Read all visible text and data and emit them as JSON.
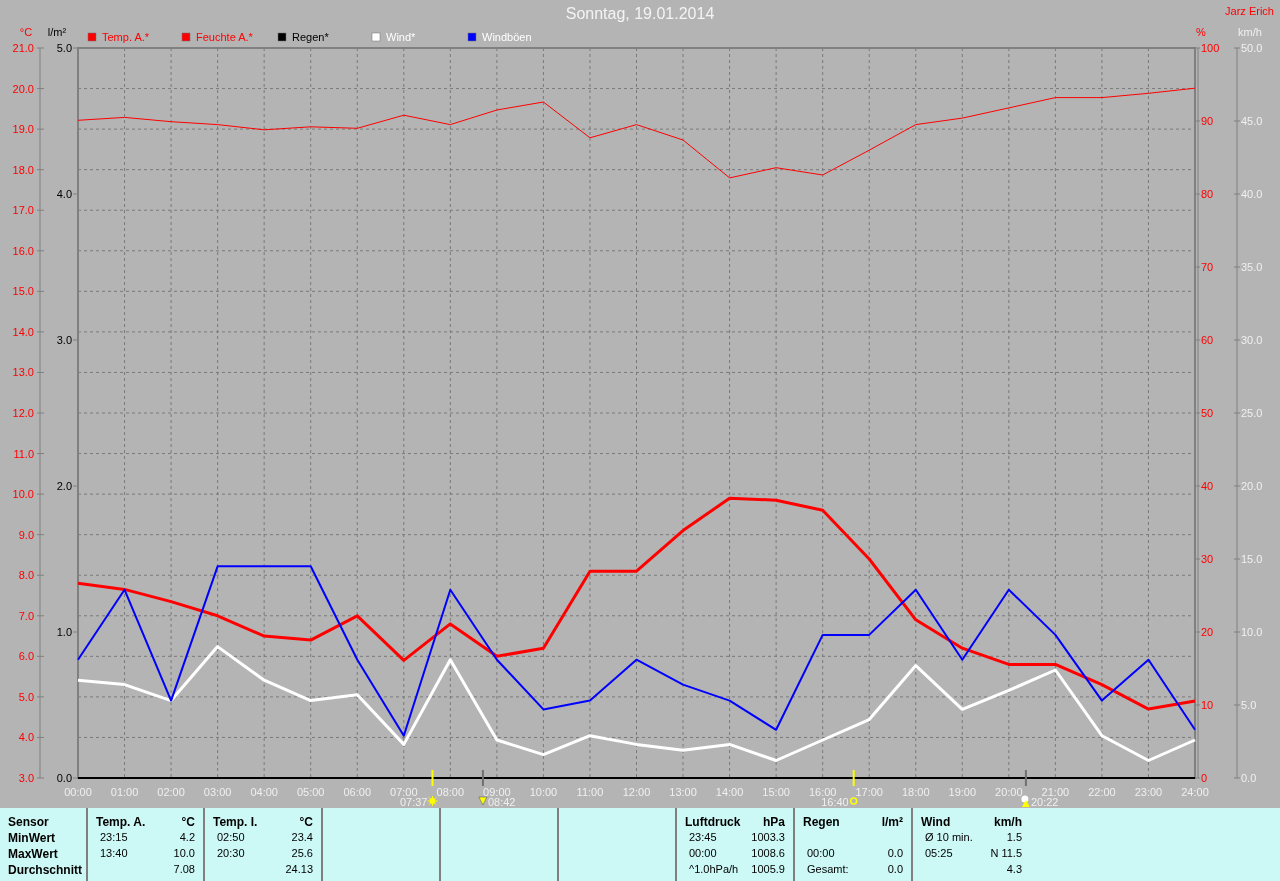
{
  "header": {
    "title": "Sonntag, 19.01.2014",
    "author": "Jarz Erich"
  },
  "chart": {
    "rain_axis": {
      "unit": "l/m²",
      "ticks": [
        "5.0",
        "4.0",
        "3.0",
        "2.0",
        "1.0",
        "0.0"
      ]
    },
    "events": [
      "07:37",
      "08:42",
      "16:40",
      "20:22"
    ],
    "chart_data": {
      "type": "line",
      "grid": true,
      "legend": "top",
      "ylabel": "°C",
      "y2label": "%",
      "y3label": "km/h",
      "ylim": [
        3,
        21
      ],
      "y2lim": [
        0,
        100
      ],
      "y3lim": [
        0,
        50
      ],
      "xlim": [
        0,
        24
      ],
      "x": [
        0,
        1,
        2,
        3,
        4,
        5,
        6,
        7,
        8,
        9,
        10,
        11,
        12,
        13,
        14,
        15,
        16,
        17,
        18,
        19,
        20,
        21,
        22,
        23,
        24
      ],
      "xticks": [
        {
          "value": 0,
          "label": "00:00"
        },
        {
          "value": 1,
          "label": "01:00"
        },
        {
          "value": 2,
          "label": "02:00"
        },
        {
          "value": 3,
          "label": "03:00"
        },
        {
          "value": 4,
          "label": "04:00"
        },
        {
          "value": 5,
          "label": "05:00"
        },
        {
          "value": 6,
          "label": "06:00"
        },
        {
          "value": 7,
          "label": "07:00"
        },
        {
          "value": 8,
          "label": "08:00"
        },
        {
          "value": 9,
          "label": "09:00"
        },
        {
          "value": 10,
          "label": "10:00"
        },
        {
          "value": 11,
          "label": "11:00"
        },
        {
          "value": 12,
          "label": "12:00"
        },
        {
          "value": 13,
          "label": "13:00"
        },
        {
          "value": 14,
          "label": "14:00"
        },
        {
          "value": 15,
          "label": "15:00"
        },
        {
          "value": 16,
          "label": "16:00"
        },
        {
          "value": 17,
          "label": "17:00"
        },
        {
          "value": 18,
          "label": "18:00"
        },
        {
          "value": 19,
          "label": "19:00"
        },
        {
          "value": 20,
          "label": "20:00"
        },
        {
          "value": 21,
          "label": "21:00"
        },
        {
          "value": 22,
          "label": "22:00"
        },
        {
          "value": 23,
          "label": "23:00"
        },
        {
          "value": 24,
          "label": "24:00"
        }
      ],
      "yticks": [
        {
          "value": 3,
          "label": "3.0"
        },
        {
          "value": 4,
          "label": "4.0"
        },
        {
          "value": 5,
          "label": "5.0"
        },
        {
          "value": 6,
          "label": "6.0"
        },
        {
          "value": 7,
          "label": "7.0"
        },
        {
          "value": 8,
          "label": "8.0"
        },
        {
          "value": 9,
          "label": "9.0"
        },
        {
          "value": 10,
          "label": "10.0"
        },
        {
          "value": 11,
          "label": "11.0"
        },
        {
          "value": 12,
          "label": "12.0"
        },
        {
          "value": 13,
          "label": "13.0"
        },
        {
          "value": 14,
          "label": "14.0"
        },
        {
          "value": 15,
          "label": "15.0"
        },
        {
          "value": 16,
          "label": "16.0"
        },
        {
          "value": 17,
          "label": "17.0"
        },
        {
          "value": 18,
          "label": "18.0"
        },
        {
          "value": 19,
          "label": "19.0"
        },
        {
          "value": 20,
          "label": "20.0"
        },
        {
          "value": 21,
          "label": "21.0"
        }
      ],
      "y2ticks": [
        0,
        10,
        20,
        30,
        40,
        50,
        60,
        70,
        80,
        90,
        100
      ],
      "y3ticks": [
        {
          "value": 0,
          "label": "0.0"
        },
        {
          "value": 5,
          "label": "5.0"
        },
        {
          "value": 10,
          "label": "10.0"
        },
        {
          "value": 15,
          "label": "15.0"
        },
        {
          "value": 20,
          "label": "20.0"
        },
        {
          "value": 25,
          "label": "25.0"
        },
        {
          "value": 30,
          "label": "30.0"
        },
        {
          "value": 35,
          "label": "35.0"
        },
        {
          "value": 40,
          "label": "40.0"
        },
        {
          "value": 45,
          "label": "45.0"
        },
        {
          "value": 50,
          "label": "50.0"
        }
      ],
      "series": [
        {
          "name": "Temp. A.*",
          "color": "#ff0000",
          "values": [
            7.8,
            7.65,
            7.35,
            7.0,
            6.5,
            6.4,
            7.0,
            5.9,
            6.8,
            6.0,
            6.2,
            8.1,
            8.1,
            9.1,
            9.9,
            9.85,
            9.6,
            8.4,
            6.9,
            6.2,
            5.8,
            5.8,
            5.3,
            4.7,
            4.9
          ]
        },
        {
          "name": "Feuchte A.*",
          "color": "#ff0000",
          "axis": "y2",
          "values": [
            90.1,
            90.5,
            89.9,
            89.5,
            88.8,
            89.2,
            89,
            90.8,
            89.5,
            91.5,
            92.6,
            87.7,
            89.5,
            87.4,
            82.2,
            83.6,
            82.6,
            86,
            89.5,
            90.4,
            91.8,
            93.2,
            93.2,
            93.8,
            94.5
          ]
        },
        {
          "name": "Regen*",
          "color": "#000000",
          "values": [
            null,
            null,
            null,
            null,
            null,
            null,
            null,
            null,
            null,
            null,
            null,
            null,
            null,
            null,
            null,
            null,
            null,
            null,
            null,
            null,
            null,
            null,
            null,
            null,
            null
          ]
        },
        {
          "name": "Wind*",
          "color": "#ffffff",
          "axis": "y3",
          "values": [
            6.7,
            6.4,
            5.3,
            9.0,
            6.7,
            5.3,
            5.7,
            2.3,
            8.1,
            2.6,
            1.6,
            2.9,
            2.3,
            1.9,
            2.3,
            1.2,
            2.6,
            4.0,
            7.7,
            4.7,
            6.0,
            7.4,
            2.9,
            1.2,
            2.6
          ]
        },
        {
          "name": "Windböen",
          "color": "#0000ff",
          "axis": "y3",
          "values": [
            8.1,
            12.9,
            5.3,
            14.5,
            14.5,
            14.5,
            8.1,
            2.9,
            12.9,
            8.1,
            4.7,
            5.3,
            8.1,
            6.4,
            5.3,
            3.3,
            9.8,
            9.8,
            12.9,
            8.1,
            12.9,
            9.8,
            5.3,
            8.1,
            3.3
          ]
        }
      ]
    }
  },
  "stats": {
    "row_labels": [
      "Sensor",
      "MinWert",
      "MaxWert",
      "Durchschnitt"
    ],
    "columns": [
      {
        "kind": "sensor",
        "title": "Temp. A.",
        "unit": "°C",
        "rows": [
          {
            "time": "23:15",
            "value": "4.2"
          },
          {
            "time": "13:40",
            "value": "10.0"
          },
          {
            "value": "7.08"
          }
        ]
      },
      {
        "kind": "sensor",
        "title": "Temp. I.",
        "unit": "°C",
        "rows": [
          {
            "time": "02:50",
            "value": "23.4"
          },
          {
            "time": "20:30",
            "value": "25.6"
          },
          {
            "value": "24.13"
          }
        ]
      },
      {
        "kind": "empty"
      },
      {
        "kind": "empty"
      },
      {
        "kind": "empty"
      },
      {
        "kind": "sensor",
        "title": "Luftdruck",
        "unit": "hPa",
        "rows": [
          {
            "time": "23:45",
            "value": "1003.3"
          },
          {
            "time": "00:00",
            "value": "1008.6"
          },
          {
            "time": "^1.0hPa/h",
            "value": "1005.9"
          }
        ]
      },
      {
        "kind": "sensor",
        "title": "Regen",
        "unit": "l/m²",
        "rows": [
          {},
          {
            "time": "00:00",
            "value": "0.0"
          },
          {
            "time": "Gesamt:",
            "value": "0.0"
          }
        ]
      },
      {
        "kind": "sensor",
        "title": "Wind",
        "unit": "km/h",
        "rows": [
          {
            "time": "Ø 10 min.",
            "value": "1.5"
          },
          {
            "time": "05:25",
            "value": "N 11.5"
          },
          {
            "value": "4.3"
          }
        ]
      }
    ]
  }
}
